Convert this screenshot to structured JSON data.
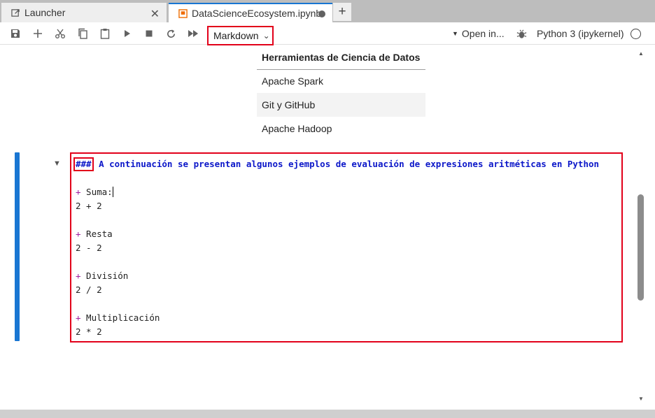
{
  "tabs": {
    "launcher_label": "Launcher",
    "notebook_label": "DataScienceEcosystem.ipynb",
    "close_glyph": "✕",
    "add_glyph": "+"
  },
  "toolbar": {
    "cell_type": "Markdown",
    "open_in": "Open in...",
    "kernel": "Python 3 (ipykernel)",
    "buttons": [
      "save-icon",
      "add-icon",
      "cut-icon",
      "copy-icon",
      "paste-icon",
      "run-icon",
      "stop-icon",
      "restart-icon",
      "fast-forward-icon"
    ]
  },
  "table": {
    "header": "Herramientas de Ciencia de Datos",
    "rows": [
      "Apache Spark",
      "Git y GitHub",
      "Apache Hadoop"
    ]
  },
  "editor": {
    "hash": "###",
    "heading": " A continuación se presentan algunos ejemplos de evaluación de expresiones aritméticas en Python",
    "bullet": "+",
    "items": [
      {
        "label": " Suma:",
        "expr": "2 + 2"
      },
      {
        "label": " Resta",
        "expr": "2 - 2"
      },
      {
        "label": " División",
        "expr": "2 / 2"
      },
      {
        "label": " Multiplicación",
        "expr": "2 * 2"
      }
    ]
  },
  "colors": {
    "accent": "#1976d2",
    "highlight_box": "#e2001a",
    "heading_text": "#0c17c9",
    "bullet": "#a020a0"
  }
}
